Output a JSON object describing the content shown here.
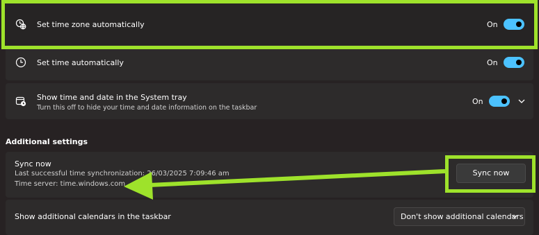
{
  "settings": {
    "time_zone_auto": {
      "label": "Set time zone automatically",
      "state": "On",
      "icon": "globe-clock-icon"
    },
    "time_auto": {
      "label": "Set time automatically",
      "state": "On",
      "icon": "clock-icon"
    },
    "system_tray": {
      "label": "Show time and date in the System tray",
      "description": "Turn this off to hide your time and date information on the taskbar",
      "state": "On",
      "icon": "calendar-clock-icon"
    }
  },
  "additional": {
    "heading": "Additional settings",
    "sync": {
      "title": "Sync now",
      "last_sync": "Last successful time synchronization: 26/03/2025 7:09:46 am",
      "server": "Time server: time.windows.com",
      "button_label": "Sync now"
    },
    "calendars": {
      "label": "Show additional calendars in the taskbar",
      "selected": "Don't show additional calendars"
    }
  },
  "annotation": {
    "highlight_color": "#9ee22b",
    "toggle_color": "#4cc2ff"
  }
}
